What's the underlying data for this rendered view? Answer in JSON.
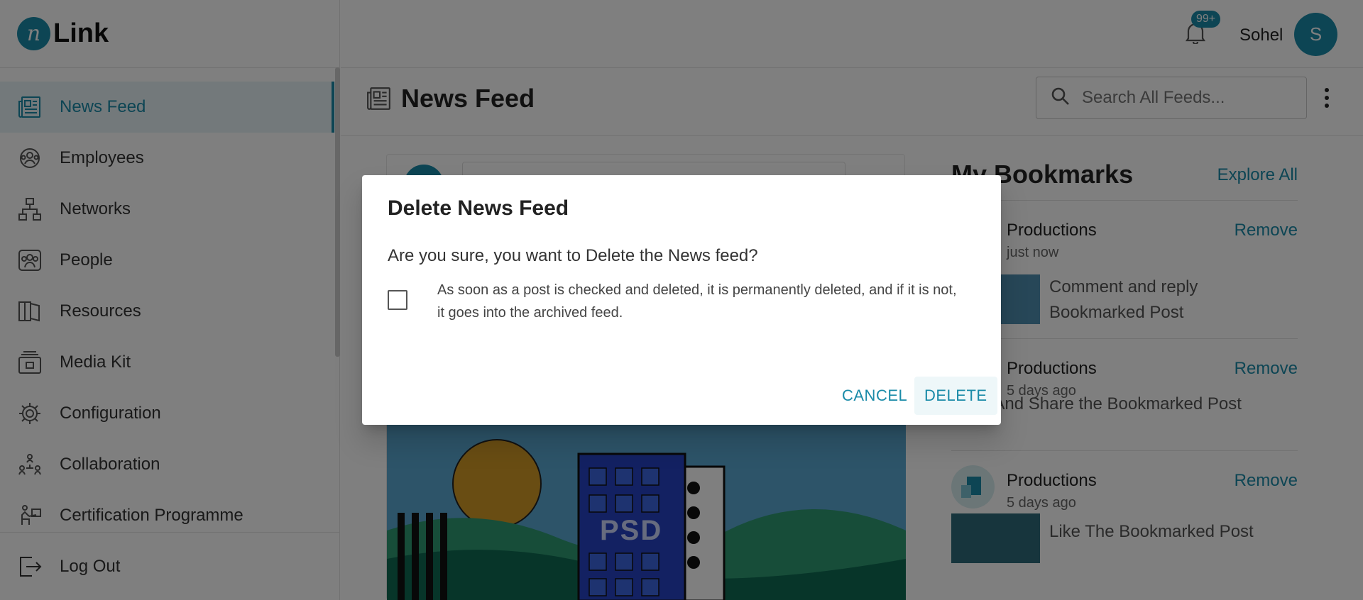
{
  "app": {
    "logo_mark": "n",
    "logo_text": "Link"
  },
  "sidebar": {
    "items": [
      {
        "label": "News Feed",
        "icon": "news-feed-icon",
        "active": true
      },
      {
        "label": "Employees",
        "icon": "employees-icon"
      },
      {
        "label": "Networks",
        "icon": "networks-icon"
      },
      {
        "label": "People",
        "icon": "people-icon"
      },
      {
        "label": "Resources",
        "icon": "resources-icon"
      },
      {
        "label": "Media Kit",
        "icon": "media-kit-icon"
      },
      {
        "label": "Configuration",
        "icon": "gear-icon"
      },
      {
        "label": "Collaboration",
        "icon": "collaboration-icon"
      },
      {
        "label": "Certification Programme",
        "icon": "certification-icon"
      }
    ],
    "logout_label": "Log Out"
  },
  "header": {
    "notification_badge": "99+",
    "user_name": "Sohel",
    "user_initial": "S"
  },
  "page": {
    "title": "News Feed",
    "search_placeholder": "Search All Feeds..."
  },
  "feed": {
    "image_label": "PSD"
  },
  "bookmarks": {
    "title": "My Bookmarks",
    "explore_label": "Explore All",
    "items": [
      {
        "name": "Productions",
        "time": "just now",
        "text": "Comment and reply Bookmarked Post",
        "remove_label": "Remove"
      },
      {
        "name": "Productions",
        "time": "5 days ago",
        "text": "Like And Share the Bookmarked Post",
        "remove_label": "Remove"
      },
      {
        "name": "Productions",
        "time": "5 days ago",
        "text": "Like The Bookmarked Post",
        "remove_label": "Remove"
      }
    ]
  },
  "dialog": {
    "title": "Delete News Feed",
    "question": "Are you sure, you want to Delete the News feed?",
    "checkbox_note": "As soon as a post is checked and deleted, it is permanently deleted, and if it is not, it goes into the archived feed.",
    "checkbox_checked": false,
    "cancel_label": "CANCEL",
    "delete_label": "DELETE"
  },
  "colors": {
    "accent": "#1a8ba8",
    "overlay": "rgba(0,0,0,0.5)"
  }
}
